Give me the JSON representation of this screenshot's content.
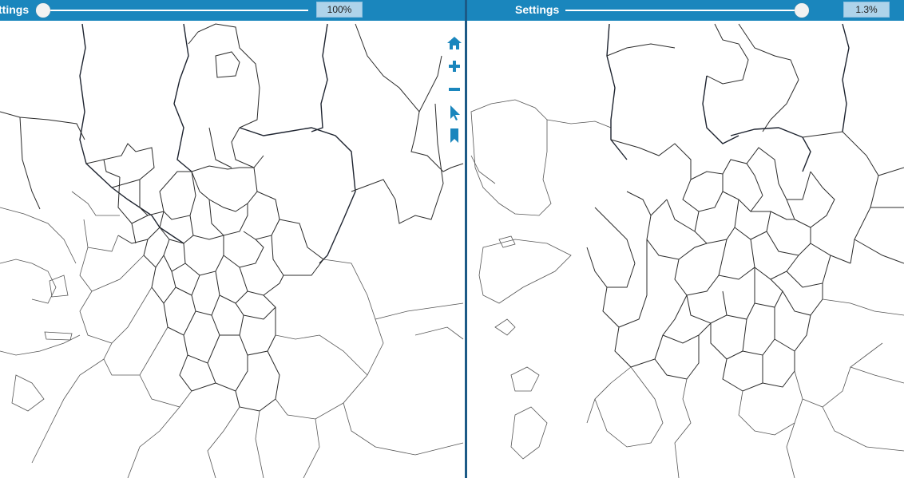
{
  "left_view": {
    "settings_label": "ttings",
    "zoom_label": "100%",
    "zoom_slider_value": 0,
    "tools": [
      {
        "name": "home-icon",
        "label": "Home"
      },
      {
        "name": "zoom-in-icon",
        "label": "Zoom in"
      },
      {
        "name": "zoom-out-icon",
        "label": "Zoom out"
      },
      {
        "name": "select-pointer-icon",
        "label": "Select"
      },
      {
        "name": "bookmark-icon",
        "label": "Bookmark"
      }
    ]
  },
  "right_view": {
    "settings_label": "Settings",
    "zoom_label": "1.3%",
    "zoom_slider_value": 1
  },
  "colors": {
    "toolbar": "#1a86bd",
    "divider": "#1c5a86",
    "zoom_box": "#aed3ea",
    "boundary_stroke": "#2b2b2b"
  }
}
